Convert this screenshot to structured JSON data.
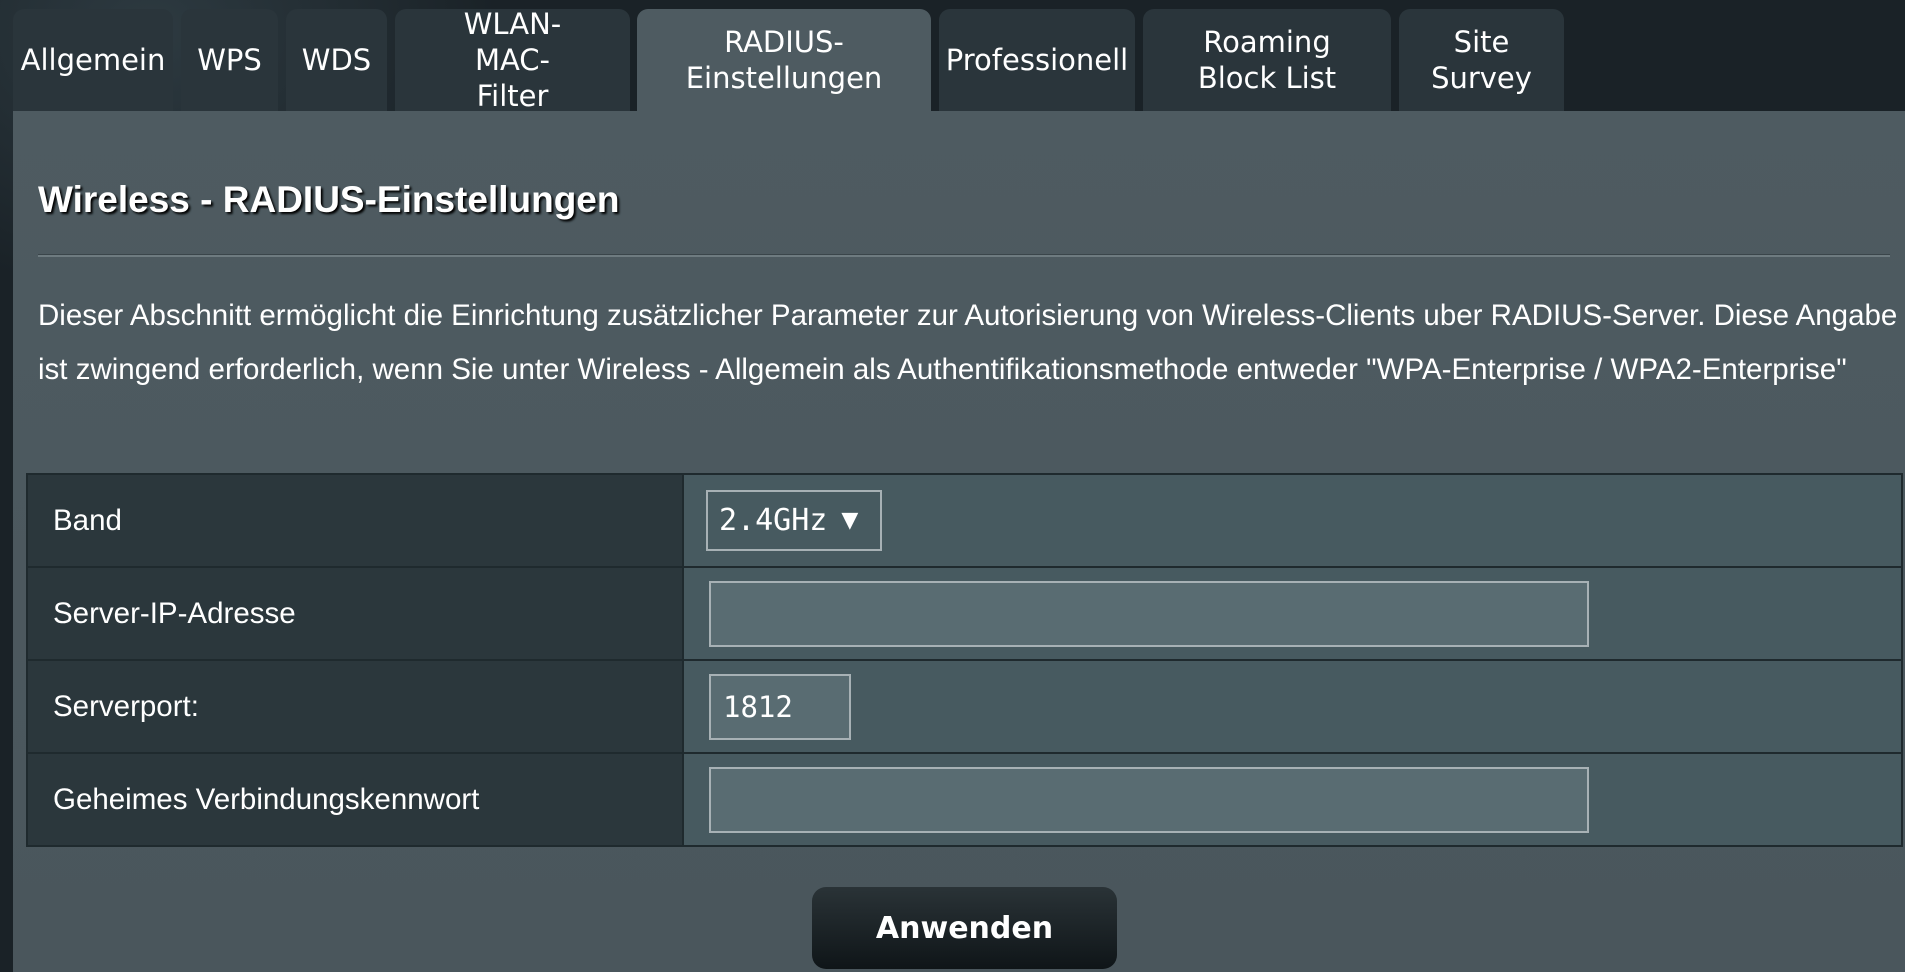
{
  "tabs": [
    {
      "label": "Allgemein"
    },
    {
      "label": "WPS"
    },
    {
      "label": "WDS"
    },
    {
      "label": "WLAN-MAC-Filter"
    },
    {
      "label": "RADIUS-Einstellungen",
      "active": true
    },
    {
      "label": "Professionell"
    },
    {
      "label": "Roaming Block List"
    },
    {
      "label": "Site Survey"
    }
  ],
  "page": {
    "title": "Wireless - RADIUS-Einstellungen",
    "description": "Dieser Abschnitt ermöglicht die Einrichtung zusätzlicher Parameter zur Autorisierung von Wireless-Clients uber RADIUS-Server. Diese Angabe ist zwingend erforderlich, wenn Sie unter Wireless - Allgemein als Authentifikationsmethode entweder \"WPA-Enterprise / WPA2-Enterprise\""
  },
  "form": {
    "band": {
      "label": "Band",
      "value": "2.4GHz",
      "icon": "caret-down-icon"
    },
    "server_ip": {
      "label": "Server-IP-Adresse",
      "value": ""
    },
    "server_port": {
      "label": "Serverport:",
      "value": "1812"
    },
    "secret": {
      "label": "Geheimes Verbindungskennwort",
      "value": ""
    }
  },
  "actions": {
    "apply_label": "Anwenden"
  },
  "colors": {
    "tab_bg": "#2a353b",
    "tab_active_bg": "#4e5b61",
    "panel_bg": "#4e5b61",
    "label_cell_bg": "#2b373c",
    "field_cell_bg": "#475a60",
    "input_bg": "#596c72",
    "button_bg": "#0f1518",
    "text": "#ffffff"
  }
}
